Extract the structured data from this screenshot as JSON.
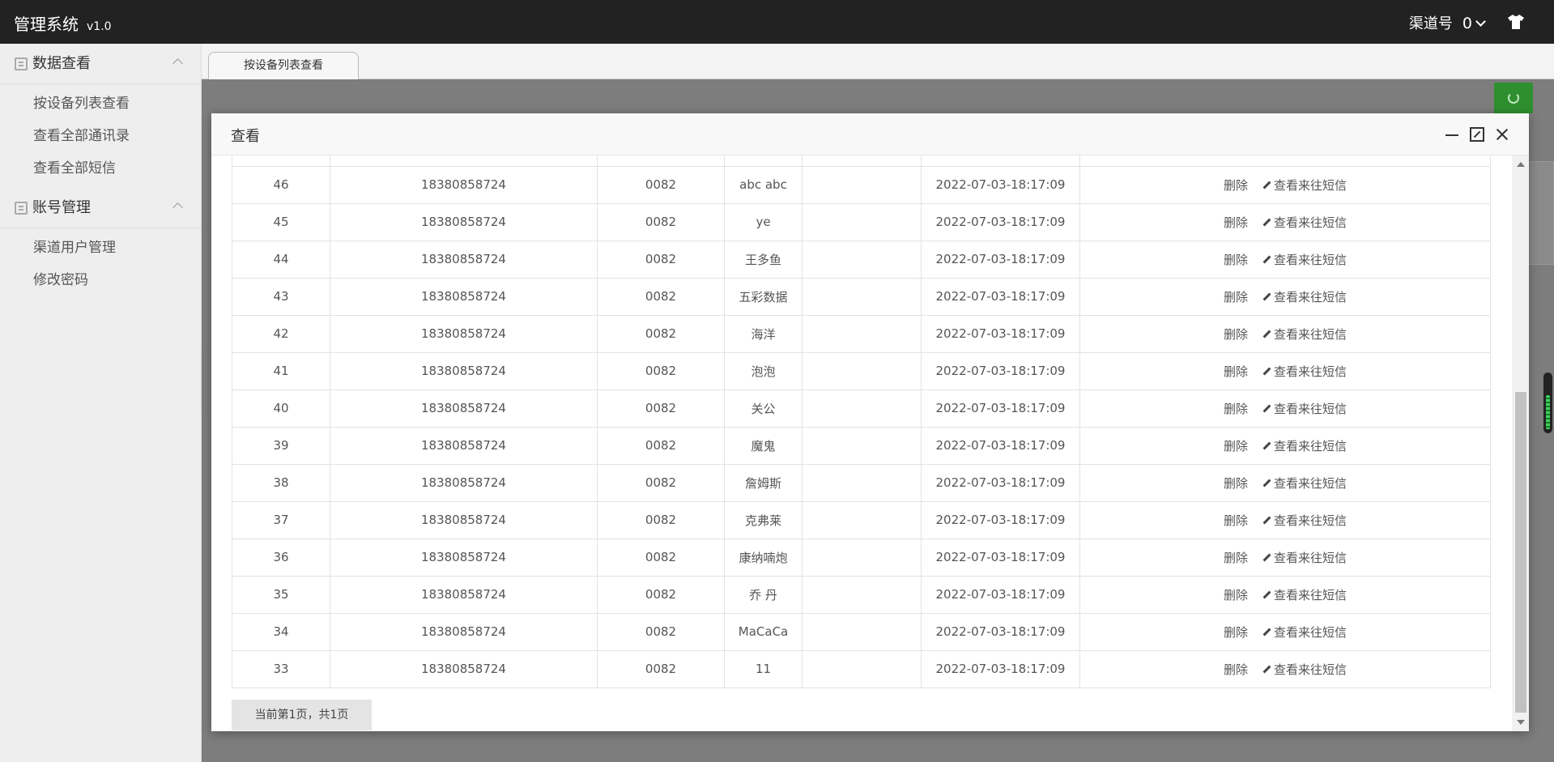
{
  "header": {
    "brand": "管理系统",
    "version": "v1.0",
    "channel_label": "渠道号",
    "channel_value": "0"
  },
  "sidebar": {
    "groups": [
      {
        "label": "数据查看",
        "items": [
          "按设备列表查看",
          "查看全部通讯录",
          "查看全部短信"
        ]
      },
      {
        "label": "账号管理",
        "items": [
          "渠道用户管理",
          "修改密码"
        ]
      }
    ]
  },
  "tabs": [
    "按设备列表查看"
  ],
  "modal": {
    "title": "查看",
    "rows": [
      {
        "id": "46",
        "phone": "18380858724",
        "code": "0082",
        "name": "abc abc",
        "time": "2022-07-03-18:17:09"
      },
      {
        "id": "45",
        "phone": "18380858724",
        "code": "0082",
        "name": "ye",
        "time": "2022-07-03-18:17:09"
      },
      {
        "id": "44",
        "phone": "18380858724",
        "code": "0082",
        "name": "王多鱼",
        "time": "2022-07-03-18:17:09"
      },
      {
        "id": "43",
        "phone": "18380858724",
        "code": "0082",
        "name": "五彩数据",
        "time": "2022-07-03-18:17:09"
      },
      {
        "id": "42",
        "phone": "18380858724",
        "code": "0082",
        "name": "海洋",
        "time": "2022-07-03-18:17:09"
      },
      {
        "id": "41",
        "phone": "18380858724",
        "code": "0082",
        "name": "泡泡",
        "time": "2022-07-03-18:17:09"
      },
      {
        "id": "40",
        "phone": "18380858724",
        "code": "0082",
        "name": "关公",
        "time": "2022-07-03-18:17:09"
      },
      {
        "id": "39",
        "phone": "18380858724",
        "code": "0082",
        "name": "魔鬼",
        "time": "2022-07-03-18:17:09"
      },
      {
        "id": "38",
        "phone": "18380858724",
        "code": "0082",
        "name": "詹姆斯",
        "time": "2022-07-03-18:17:09"
      },
      {
        "id": "37",
        "phone": "18380858724",
        "code": "0082",
        "name": "克弗莱",
        "time": "2022-07-03-18:17:09"
      },
      {
        "id": "36",
        "phone": "18380858724",
        "code": "0082",
        "name": "康纳喃炮",
        "time": "2022-07-03-18:17:09"
      },
      {
        "id": "35",
        "phone": "18380858724",
        "code": "0082",
        "name": "乔 丹",
        "time": "2022-07-03-18:17:09"
      },
      {
        "id": "34",
        "phone": "18380858724",
        "code": "0082",
        "name": "MaCaCa",
        "time": "2022-07-03-18:17:09"
      },
      {
        "id": "33",
        "phone": "18380858724",
        "code": "0082",
        "name": "11",
        "time": "2022-07-03-18:17:09"
      }
    ],
    "delete_label": "删除",
    "view_sms_label": "查看来往短信",
    "pager_text": "当前第1页，共1页"
  },
  "colors": {
    "topbar": "#222222",
    "refresh_button": "#2f8f2f",
    "overlay": "#7d7d7d"
  },
  "icons": [
    "book-icon",
    "chevron-up-icon",
    "chevron-down-icon",
    "shirt-icon",
    "refresh-icon",
    "minimize-icon",
    "maximize-icon",
    "close-icon",
    "pencil-icon"
  ]
}
